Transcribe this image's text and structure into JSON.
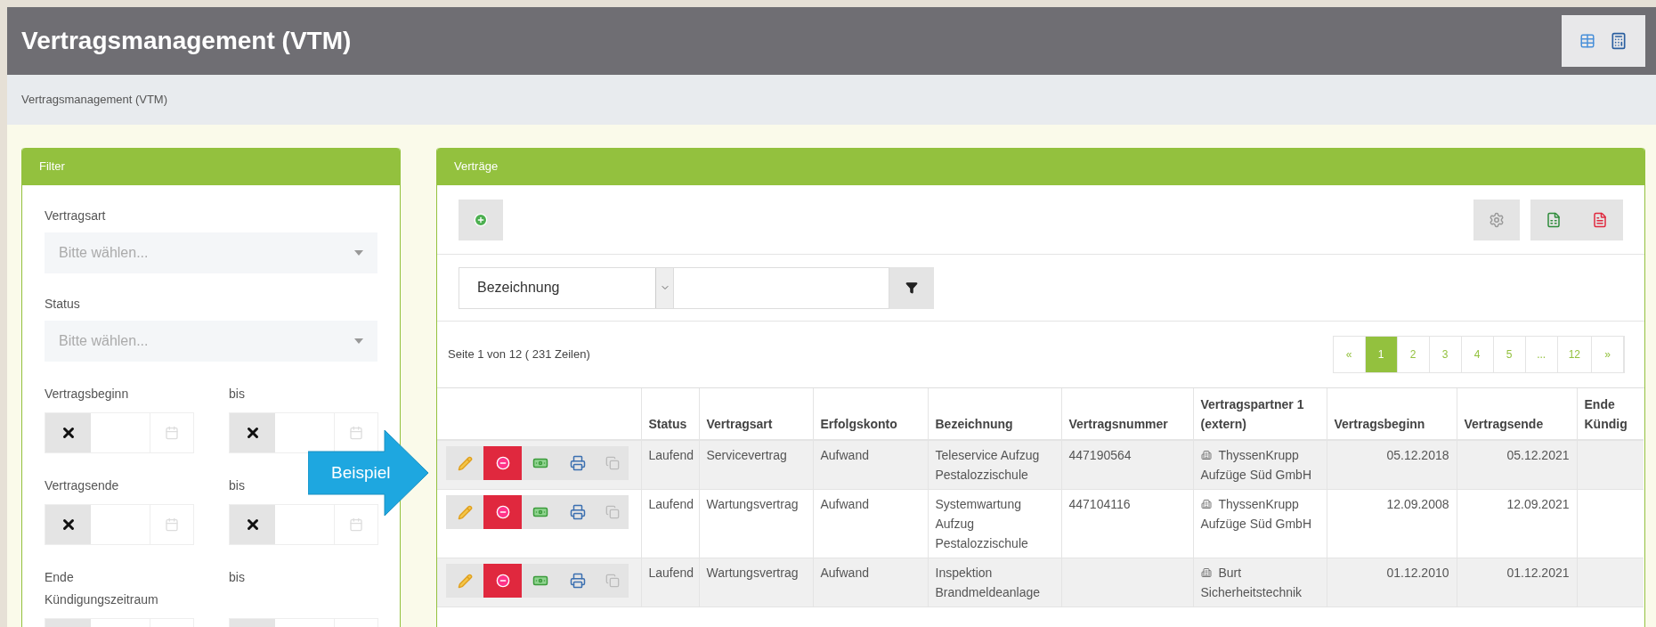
{
  "header": {
    "title": "Vertragsmanagement (VTM)"
  },
  "breadcrumb": "Vertragsmanagement (VTM)",
  "filter_panel": {
    "title": "Filter",
    "fields": [
      {
        "kind": "select",
        "label": "Vertragsart",
        "placeholder": "Bitte wählen..."
      },
      {
        "kind": "select",
        "label": "Status",
        "placeholder": "Bitte wählen..."
      },
      {
        "kind": "date_range",
        "label": "Vertragsbeginn",
        "to_label": "bis"
      },
      {
        "kind": "date_range",
        "label": "Vertragsende",
        "to_label": "bis"
      },
      {
        "kind": "date_range",
        "label": "Ende Kündigungszeitraum",
        "to_label": "bis"
      }
    ]
  },
  "contracts_panel": {
    "title": "Verträge",
    "search": {
      "column": "Bezeichnung"
    },
    "page_info": "Seite 1 von 12 ( 231 Zeilen)",
    "pagination": [
      {
        "label": "«",
        "selected": false
      },
      {
        "label": "1",
        "selected": true
      },
      {
        "label": "2",
        "selected": false
      },
      {
        "label": "3",
        "selected": false
      },
      {
        "label": "4",
        "selected": false
      },
      {
        "label": "5",
        "selected": false
      },
      {
        "label": "...",
        "selected": false
      },
      {
        "label": "12",
        "selected": false
      },
      {
        "label": "»",
        "selected": false
      }
    ],
    "table": {
      "columns": [
        {
          "label": "Status",
          "kind": "text"
        },
        {
          "label": "Vertragsart",
          "kind": "text"
        },
        {
          "label": "Erfolgskonto",
          "kind": "text"
        },
        {
          "label": "Bezeichnung",
          "kind": "text"
        },
        {
          "label": "Vertragsnummer",
          "kind": "text"
        },
        {
          "label": "Vertragspartner 1 (extern)",
          "kind": "partner"
        },
        {
          "label": "Vertragsbeginn",
          "kind": "date"
        },
        {
          "label": "Vertragsende",
          "kind": "date"
        },
        {
          "label": "Ende Kündig",
          "kind": "date"
        }
      ],
      "rows": [
        {
          "cells": [
            "Laufend",
            "Servicevertrag",
            "Aufwand",
            "Teleservice Aufzug Pestalozzischule",
            "447190564",
            "ThyssenKrupp Aufzüge Süd GmbH",
            "05.12.2018",
            "05.12.2021",
            ""
          ]
        },
        {
          "cells": [
            "Laufend",
            "Wartungsvertrag",
            "Aufwand",
            "Systemwartung Aufzug Pestalozzischule",
            "447104116",
            "ThyssenKrupp Aufzüge Süd GmbH",
            "12.09.2008",
            "12.09.2021",
            ""
          ]
        },
        {
          "cells": [
            "Laufend",
            "Wartungsvertrag",
            "Aufwand",
            "Inspektion Brandmeldeanlage",
            "",
            "Burt Sicherheitstechnik",
            "01.12.2010",
            "01.12.2021",
            ""
          ]
        }
      ]
    }
  },
  "callout": {
    "label": "Beispiel"
  }
}
